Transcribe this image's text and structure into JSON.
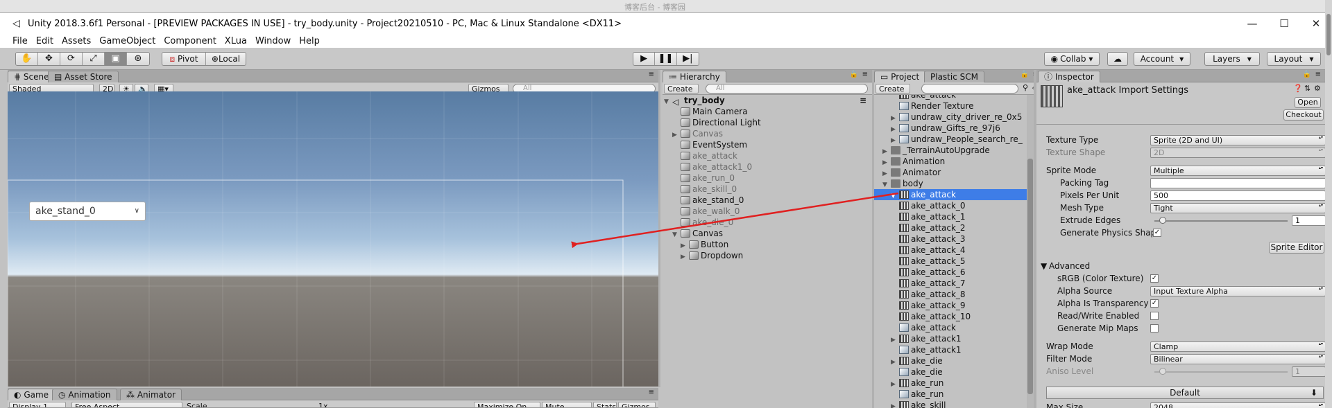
{
  "window": {
    "title": "Unity 2018.3.6f1 Personal - [PREVIEW PACKAGES IN USE] - try_body.unity - Project20210510 - PC, Mac & Linux Standalone <DX11>",
    "minimize": "—",
    "maximize": "☐",
    "close": "✕",
    "background_hint": "博客后台 - 博客园"
  },
  "menu": [
    "File",
    "Edit",
    "Assets",
    "GameObject",
    "Component",
    "XLua",
    "Window",
    "Help"
  ],
  "toolbar": {
    "pivot": "Pivot",
    "local": "Local",
    "collab": "Collab ▾",
    "account": "Account",
    "layers": "Layers",
    "layout": "Layout"
  },
  "scene": {
    "tab_scene": "Scene",
    "tab_asset_store": "Asset Store",
    "shading": "Shaded",
    "mode_2d": "2D",
    "gizmos": "Gizmos",
    "search_placeholder": "All",
    "dropdown_value": "ake_stand_0"
  },
  "game": {
    "tab_game": "Game",
    "tab_animation": "Animation",
    "tab_animator": "Animator",
    "display": "Display 1",
    "aspect": "Free Aspect",
    "scale": "Scale",
    "scale_value": "1x",
    "maximize": "Maximize On Play",
    "mute": "Mute Audio",
    "stats": "Stats",
    "gizmos": "Gizmos"
  },
  "hierarchy": {
    "tab": "Hierarchy",
    "create": "Create",
    "search_placeholder": "All",
    "scene": "try_body",
    "items": [
      {
        "label": "Main Camera"
      },
      {
        "label": "Directional Light"
      },
      {
        "label": "Canvas"
      },
      {
        "label": "EventSystem"
      },
      {
        "label": "ake_attack"
      },
      {
        "label": "ake_attack1_0"
      },
      {
        "label": "ake_run_0"
      },
      {
        "label": "ake_skill_0"
      },
      {
        "label": "ake_stand_0"
      },
      {
        "label": "ake_walk_0"
      },
      {
        "label": "ake_die_0"
      },
      {
        "label": "Canvas"
      },
      {
        "label": "Button"
      },
      {
        "label": "Dropdown"
      }
    ]
  },
  "project": {
    "tab": "Project",
    "tab_plastic": "Plastic SCM",
    "create": "Create",
    "items": [
      {
        "label": "ake_attack"
      },
      {
        "label": "Render Texture"
      },
      {
        "label": "undraw_city_driver_re_0x5"
      },
      {
        "label": "undraw_Gifts_re_97j6"
      },
      {
        "label": "undraw_People_search_re_"
      },
      {
        "label": "_TerrainAutoUpgrade"
      },
      {
        "label": "Animation"
      },
      {
        "label": "Animator"
      },
      {
        "label": "body"
      },
      {
        "label": "ake_attack"
      },
      {
        "label": "ake_attack_0"
      },
      {
        "label": "ake_attack_1"
      },
      {
        "label": "ake_attack_2"
      },
      {
        "label": "ake_attack_3"
      },
      {
        "label": "ake_attack_4"
      },
      {
        "label": "ake_attack_5"
      },
      {
        "label": "ake_attack_6"
      },
      {
        "label": "ake_attack_7"
      },
      {
        "label": "ake_attack_8"
      },
      {
        "label": "ake_attack_9"
      },
      {
        "label": "ake_attack_10"
      },
      {
        "label": "ake_attack"
      },
      {
        "label": "ake_attack1"
      },
      {
        "label": "ake_attack1"
      },
      {
        "label": "ake_die"
      },
      {
        "label": "ake_die"
      },
      {
        "label": "ake_run"
      },
      {
        "label": "ake_run"
      },
      {
        "label": "ake_skill"
      }
    ]
  },
  "inspector": {
    "tab": "Inspector",
    "title": "ake_attack Import Settings",
    "open": "Open",
    "checkout": "Checkout",
    "texture_type_label": "Texture Type",
    "texture_type": "Sprite (2D and UI)",
    "texture_shape_label": "Texture Shape",
    "texture_shape": "2D",
    "sprite_mode_label": "Sprite Mode",
    "sprite_mode": "Multiple",
    "packing_tag_label": "Packing Tag",
    "packing_tag": "",
    "ppu_label": "Pixels Per Unit",
    "ppu": "500",
    "mesh_type_label": "Mesh Type",
    "mesh_type": "Tight",
    "extrude_label": "Extrude Edges",
    "extrude": "1",
    "extrude_fraction": 0.06,
    "gen_physics_label": "Generate Physics Shap",
    "sprite_editor": "Sprite Editor",
    "advanced": "Advanced",
    "srgb_label": "sRGB (Color Texture)",
    "alpha_source_label": "Alpha Source",
    "alpha_source": "Input Texture Alpha",
    "alpha_transp_label": "Alpha Is Transparency",
    "rw_label": "Read/Write Enabled",
    "mip_label": "Generate Mip Maps",
    "wrap_label": "Wrap Mode",
    "wrap": "Clamp",
    "filter_label": "Filter Mode",
    "filter": "Bilinear",
    "aniso_label": "Aniso Level",
    "aniso": "1",
    "aniso_fraction": 0.06,
    "default_tab": "Default",
    "max_size_label": "Max Size",
    "max_size": "2048",
    "check": "✓"
  },
  "colors": {
    "selection": "#3e7de7",
    "arrow": "#e02020"
  }
}
